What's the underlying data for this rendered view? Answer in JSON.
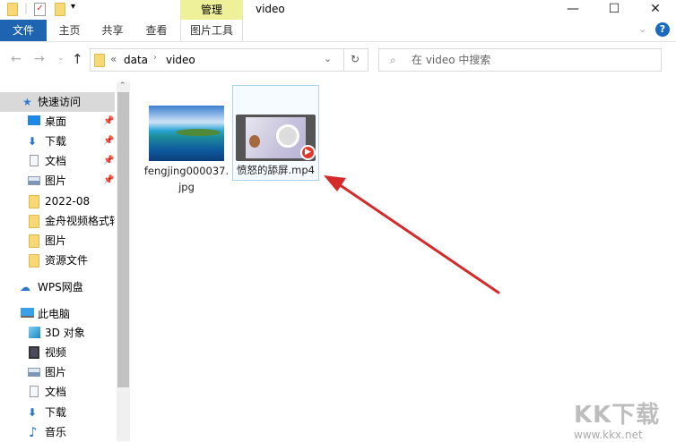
{
  "window": {
    "title": "video",
    "context_tab": "管理",
    "minimize": "—",
    "maximize": "☐",
    "close": "✕"
  },
  "ribbon": {
    "tabs": [
      "文件",
      "主页",
      "共享",
      "查看",
      "图片工具"
    ],
    "help": "?"
  },
  "address": {
    "path": [
      "data",
      "video"
    ],
    "overflow": "«",
    "search_placeholder": "在 video 中搜索"
  },
  "nav": {
    "quick_access": "快速访问",
    "quick_items": [
      {
        "label": "桌面",
        "pinned": true
      },
      {
        "label": "下载",
        "pinned": true
      },
      {
        "label": "文档",
        "pinned": true
      },
      {
        "label": "图片",
        "pinned": true
      },
      {
        "label": "2022-08"
      },
      {
        "label": "金舟视频格式转"
      },
      {
        "label": "图片"
      },
      {
        "label": "资源文件"
      }
    ],
    "wps": "WPS网盘",
    "this_pc": "此电脑",
    "pc_items": [
      "3D 对象",
      "视频",
      "图片",
      "文档",
      "下载",
      "音乐"
    ]
  },
  "files": [
    {
      "name_line1": "fengjing000037.",
      "name_line2": "jpg"
    },
    {
      "name": "愤怒的舔屏.mp4",
      "selected": true
    }
  ],
  "annotation": {
    "color": "#d42a2a"
  },
  "watermark": {
    "logo": "KK下载",
    "url": "www.kkx.net"
  }
}
